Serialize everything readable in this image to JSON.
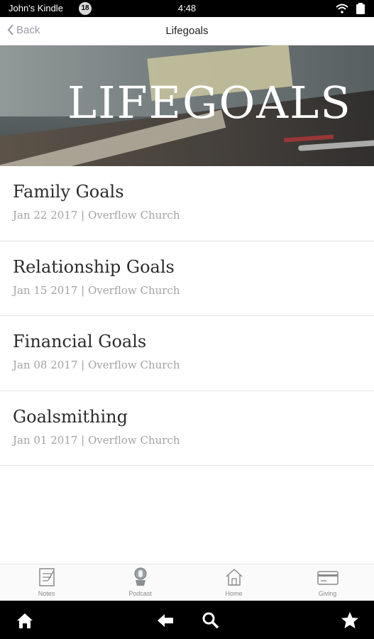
{
  "status_bar": {
    "device_name": "John's Kindle",
    "notification_count": "18",
    "time": "4:48",
    "icons": [
      "wifi-icon",
      "battery-icon"
    ]
  },
  "header": {
    "back_label": "Back",
    "title": "Lifegoals"
  },
  "banner": {
    "logo_text": "LIFEGOALS"
  },
  "sermons": [
    {
      "title": "Family Goals",
      "subtitle": "Jan 22 2017 | Overflow Church"
    },
    {
      "title": "Relationship Goals",
      "subtitle": "Jan 15 2017 | Overflow Church"
    },
    {
      "title": "Financial Goals",
      "subtitle": "Jan 08 2017 | Overflow Church"
    },
    {
      "title": "Goalsmithing",
      "subtitle": "Jan 01 2017 | Overflow Church"
    }
  ],
  "tabs": [
    {
      "label": "Notes",
      "icon": "notes-icon"
    },
    {
      "label": "Podcast",
      "icon": "podcast-icon"
    },
    {
      "label": "Home",
      "icon": "home-icon"
    },
    {
      "label": "Giving",
      "icon": "credit-card-icon"
    }
  ],
  "system_nav": {
    "icons": [
      "home-icon",
      "back-arrow-icon",
      "search-icon",
      "star-icon"
    ]
  },
  "colors": {
    "status_bar_bg": "#000000",
    "back_link": "#9a9aa8",
    "list_title": "#2b2b2b",
    "list_subtitle": "#a3a3a3",
    "tab_label": "#8a8a8a"
  }
}
